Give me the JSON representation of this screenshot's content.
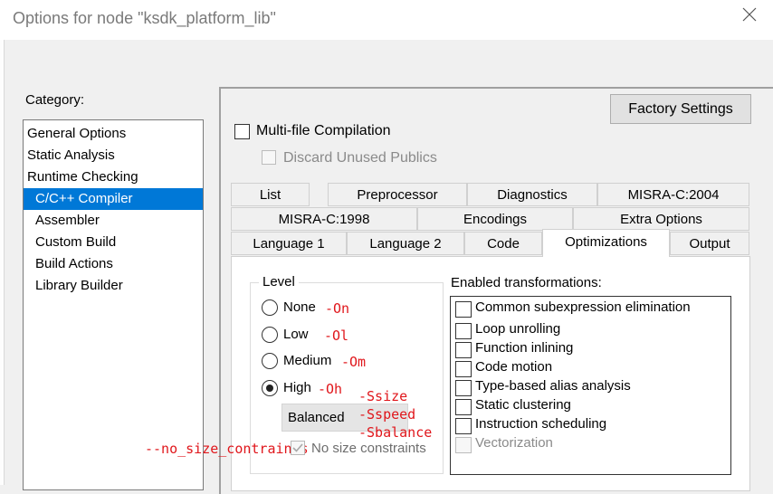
{
  "window": {
    "title": "Options for node \"ksdk_platform_lib\""
  },
  "category": {
    "label": "Category:",
    "items": [
      {
        "label": "General Options",
        "selected": false
      },
      {
        "label": "Static Analysis",
        "selected": false
      },
      {
        "label": "Runtime Checking",
        "selected": false
      },
      {
        "label": "C/C++ Compiler",
        "selected": true
      },
      {
        "label": "Assembler",
        "selected": false
      },
      {
        "label": "Custom Build",
        "selected": false
      },
      {
        "label": "Build Actions",
        "selected": false
      },
      {
        "label": "Library Builder",
        "selected": false
      }
    ]
  },
  "buttons": {
    "factory_settings": "Factory Settings"
  },
  "options": {
    "multi_file": {
      "label": "Multi-file Compilation",
      "checked": false
    },
    "discard_unused": {
      "label": "Discard Unused Publics",
      "checked": false,
      "enabled": false
    }
  },
  "tabs": {
    "row1": [
      "List",
      "Preprocessor",
      "Diagnostics",
      "MISRA-C:2004"
    ],
    "row2": [
      "MISRA-C:1998",
      "Encodings",
      "Extra Options"
    ],
    "row3": [
      "Language 1",
      "Language 2",
      "Code",
      "Optimizations",
      "Output"
    ],
    "active": "Optimizations"
  },
  "level": {
    "label": "Level",
    "options": [
      {
        "label": "None",
        "flag": "-On",
        "selected": false
      },
      {
        "label": "Low",
        "flag": "-Ol",
        "selected": false
      },
      {
        "label": "Medium",
        "flag": "-Om",
        "selected": false
      },
      {
        "label": "High",
        "flag": "-Oh",
        "selected": true
      }
    ],
    "balance": {
      "value": "Balanced",
      "flags": [
        "-Ssize",
        "-Sspeed",
        "-Sbalance"
      ]
    },
    "no_size": {
      "label": "No size constraints",
      "flag": "--no_size_contraints",
      "checked": true,
      "enabled": false
    }
  },
  "transformations": {
    "label": "Enabled transformations:",
    "items": [
      {
        "label": "Common subexpression elimination",
        "checked": false,
        "enabled": true
      },
      {
        "label": "Loop unrolling",
        "checked": false,
        "enabled": true
      },
      {
        "label": "Function inlining",
        "checked": false,
        "enabled": true
      },
      {
        "label": "Code motion",
        "checked": false,
        "enabled": true
      },
      {
        "label": "Type-based alias analysis",
        "checked": false,
        "enabled": true
      },
      {
        "label": "Static clustering",
        "checked": false,
        "enabled": true
      },
      {
        "label": "Instruction scheduling",
        "checked": false,
        "enabled": true
      },
      {
        "label": "Vectorization",
        "checked": false,
        "enabled": false
      }
    ]
  },
  "colors": {
    "selection": "#0078d7",
    "annotation": "#e0161b"
  }
}
